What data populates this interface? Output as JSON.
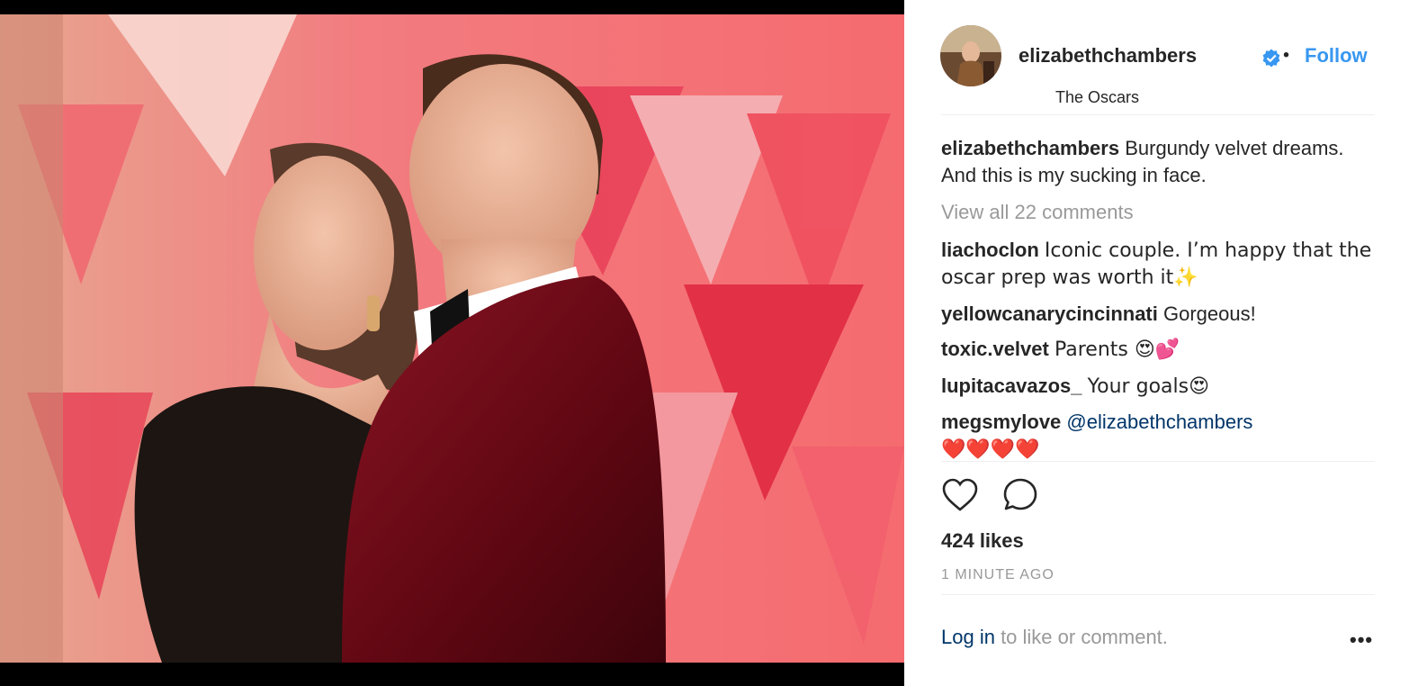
{
  "post": {
    "username": "elizabethchambers",
    "location": "The Oscars",
    "follow_label": "Follow",
    "separator": "•",
    "caption": "Burgundy velvet dreams. And this is my sucking in face.",
    "view_all_comments": "View all 22 comments",
    "likes": "424 likes",
    "timestamp": "1 MINUTE AGO"
  },
  "comments": [
    {
      "user": "liachoclon",
      "text": "Iconic couple. I’m happy that the oscar prep was worth it✨"
    },
    {
      "user": "yellowcanarycincinnati",
      "text": "Gorgeous!"
    },
    {
      "user": "toxic.velvet",
      "text": "Parents 😍💕"
    },
    {
      "user": "lupitacavazos_",
      "text": "Your goals😍"
    },
    {
      "user": "megsmylove",
      "mention": "@elizabethchambers",
      "text": "❤️❤️❤️❤️"
    }
  ],
  "footer": {
    "login_label": "Log in",
    "login_suffix": " to like or comment.",
    "more_label": "•••"
  },
  "colors": {
    "accent": "#3897f0",
    "link_dark": "#003569",
    "muted": "#999999",
    "backdrop_red": "#d0122f",
    "velvet": "#5e0712"
  }
}
